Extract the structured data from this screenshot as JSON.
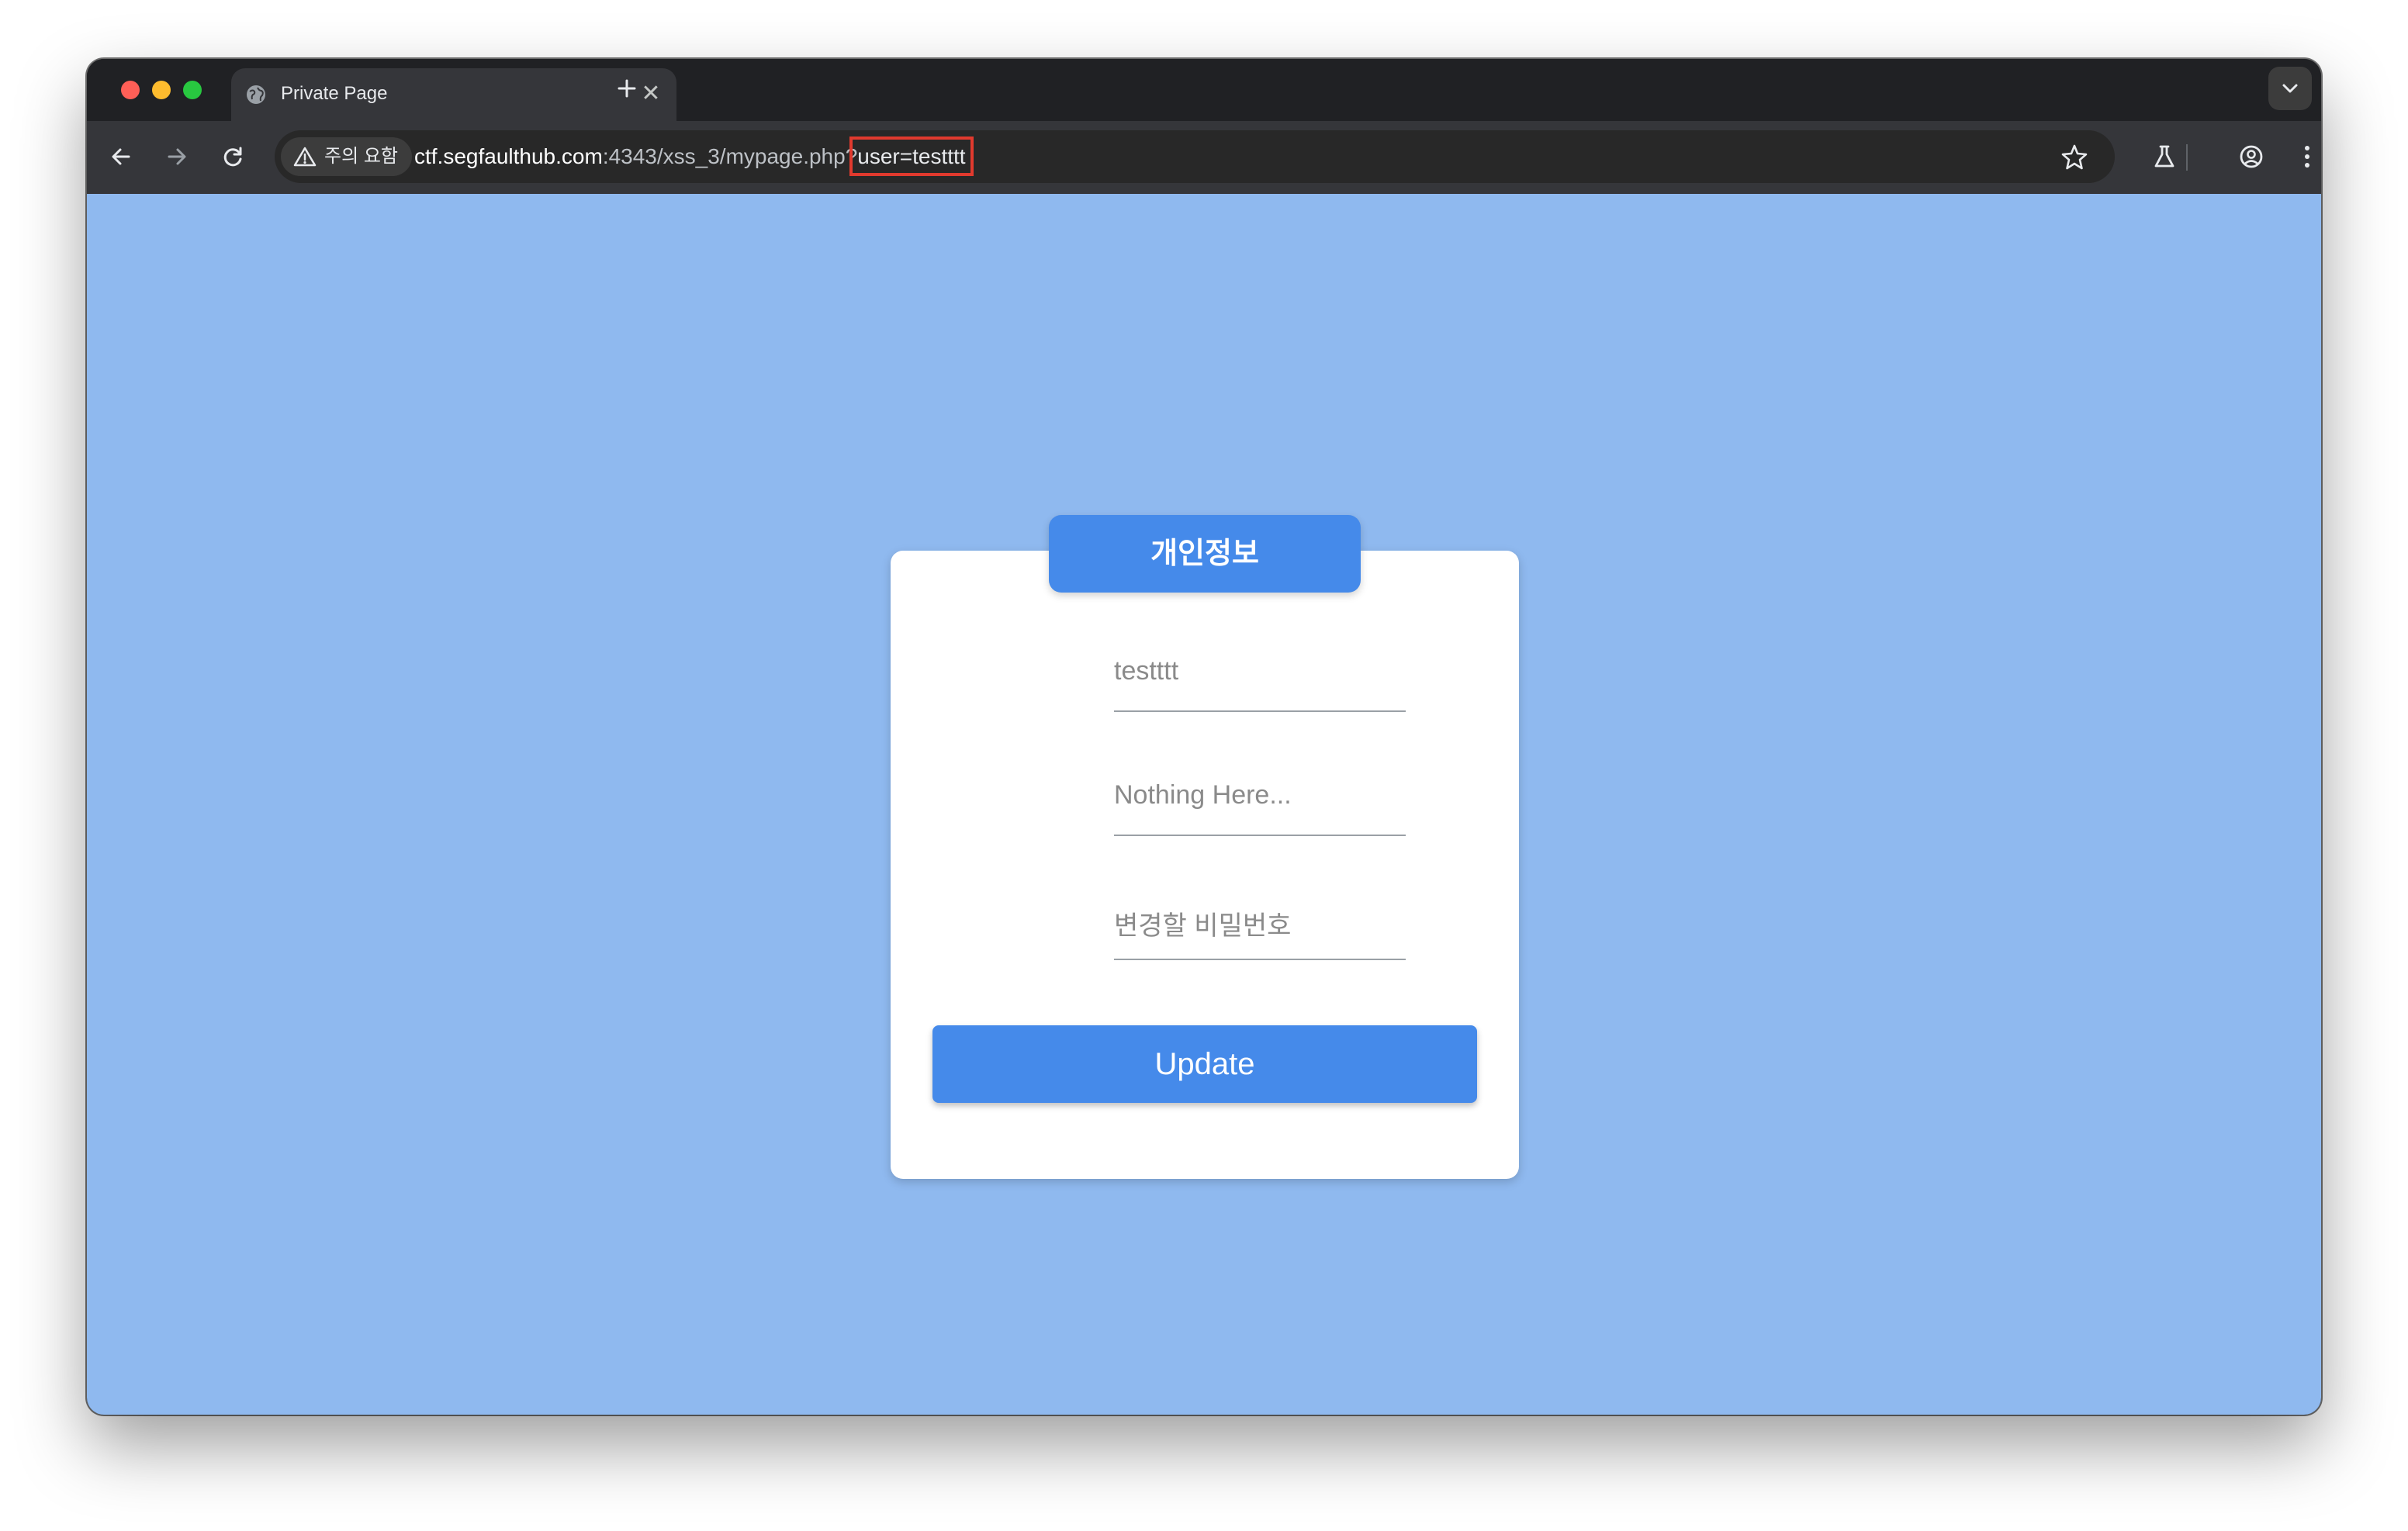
{
  "browser": {
    "tab": {
      "title": "Private Page",
      "close_symbol": "✕",
      "favicon": "globe-icon"
    },
    "new_tab_icon": "plus-icon",
    "tab_search_icon": "chevron-down-icon",
    "nav": {
      "back_icon": "arrow-left-icon",
      "forward_icon": "arrow-right-icon",
      "reload_icon": "reload-icon"
    },
    "security_chip": {
      "icon": "warning-triangle-icon",
      "label": "주의 요함"
    },
    "url": {
      "host": "ctf.segfaulthub.com",
      "rest": ":4343/xss_3/mypage.php?",
      "highlighted_query": "user=testttt"
    },
    "right_icons": [
      "star-icon",
      "labs-flask-icon",
      "profile-icon",
      "more-vert-icon"
    ]
  },
  "page": {
    "background_color": "#8fb9ef",
    "accent_color": "#458aea",
    "header_title": "개인정보",
    "fields": {
      "username_value": "testttt",
      "info_placeholder": "Nothing Here...",
      "password_placeholder": "변경할 비밀번호"
    },
    "update_label": "Update"
  }
}
